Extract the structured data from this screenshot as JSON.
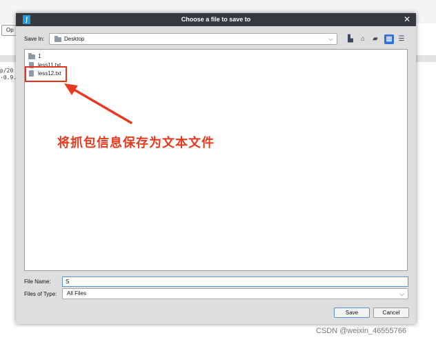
{
  "background": {
    "open_button_label": "Op",
    "lines": [
      "p/20",
      "·0.9."
    ]
  },
  "dialog": {
    "title": "Choose a file to save to",
    "save_in_label": "Save In:",
    "save_in_value": "Desktop",
    "files": [
      {
        "name": "1",
        "type": "folder"
      },
      {
        "name": "less11.txt",
        "type": "file"
      },
      {
        "name": "less12.txt",
        "type": "file"
      }
    ],
    "file_name_label": "File Name:",
    "file_name_value": "S",
    "file_type_label": "Files of Type:",
    "file_type_value": "All Files",
    "save_label": "Save",
    "cancel_label": "Cancel"
  },
  "annotation": {
    "text": "将抓包信息保存为文本文件",
    "color": "#e8391e"
  },
  "watermark": "CSDN @weixin_46555766",
  "icons": [
    "app-icon",
    "close-icon",
    "folder-icon",
    "up-folder-icon",
    "home-icon",
    "new-folder-icon",
    "list-view-icon",
    "details-view-icon",
    "file-icon",
    "chevron-down-icon",
    "arrow-annotation"
  ]
}
